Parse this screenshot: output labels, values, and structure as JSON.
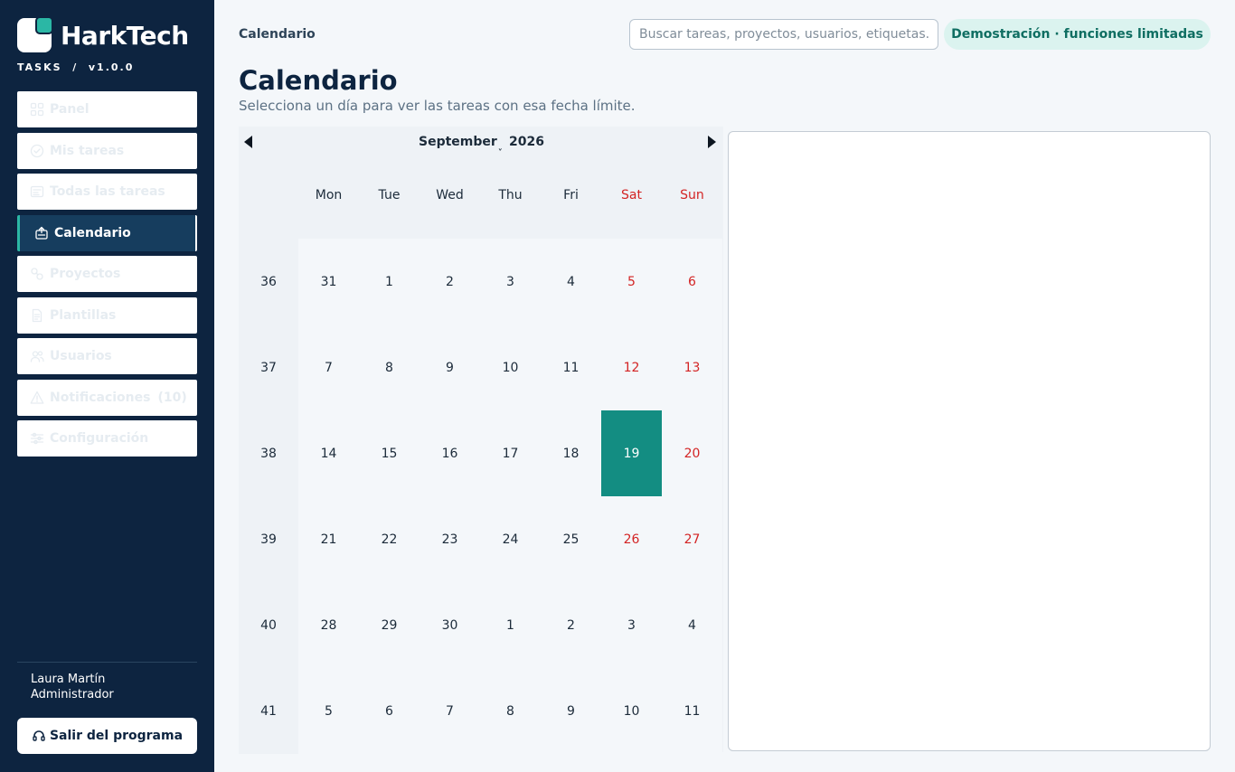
{
  "brand": {
    "name": "HarkTech",
    "subtitle": "TASKS  /  v1.0.0"
  },
  "nav": [
    {
      "label": "Panel",
      "icon": "grid-icon"
    },
    {
      "label": "Mis tareas",
      "icon": "check-circle-icon"
    },
    {
      "label": "Todas las tareas",
      "icon": "list-icon"
    },
    {
      "label": "Calendario",
      "icon": "calendar-icon",
      "active": true
    },
    {
      "label": "Proyectos",
      "icon": "projects-icon"
    },
    {
      "label": "Plantillas",
      "icon": "document-icon"
    },
    {
      "label": "Usuarios",
      "icon": "users-icon"
    },
    {
      "label": "Notificaciones",
      "count": "(10)",
      "icon": "warning-icon"
    },
    {
      "label": "Configuración",
      "icon": "sliders-icon"
    }
  ],
  "user": {
    "name": "Laura Martín",
    "role": "Administrador"
  },
  "exit_label": "Salir del programa",
  "header": {
    "breadcrumb": "Calendario",
    "search_placeholder": "Buscar tareas, proyectos, usuarios, etiquetas...",
    "demo_badge": "Demostración · funciones limitadas"
  },
  "page": {
    "title": "Calendario",
    "subtitle": "Selecciona un día para ver las tareas con esa fecha límite."
  },
  "calendar": {
    "month": "September",
    "year": "2026",
    "weekdays": [
      "Mon",
      "Tue",
      "Wed",
      "Thu",
      "Fri",
      "Sat",
      "Sun"
    ],
    "weeks": [
      {
        "num": "36",
        "days": [
          "31",
          "1",
          "2",
          "3",
          "4",
          "5",
          "6"
        ]
      },
      {
        "num": "37",
        "days": [
          "7",
          "8",
          "9",
          "10",
          "11",
          "12",
          "13"
        ]
      },
      {
        "num": "38",
        "days": [
          "14",
          "15",
          "16",
          "17",
          "18",
          "19",
          "20"
        ]
      },
      {
        "num": "39",
        "days": [
          "21",
          "22",
          "23",
          "24",
          "25",
          "26",
          "27"
        ]
      },
      {
        "num": "40",
        "days": [
          "28",
          "29",
          "30",
          "1",
          "2",
          "3",
          "4"
        ]
      },
      {
        "num": "41",
        "days": [
          "5",
          "6",
          "7",
          "8",
          "9",
          "10",
          "11"
        ]
      }
    ],
    "selected": {
      "week": 2,
      "day": 5
    },
    "colors": {
      "selected": "#138d82",
      "weekend": "#d32424",
      "accent": "#2bb7a5"
    }
  }
}
